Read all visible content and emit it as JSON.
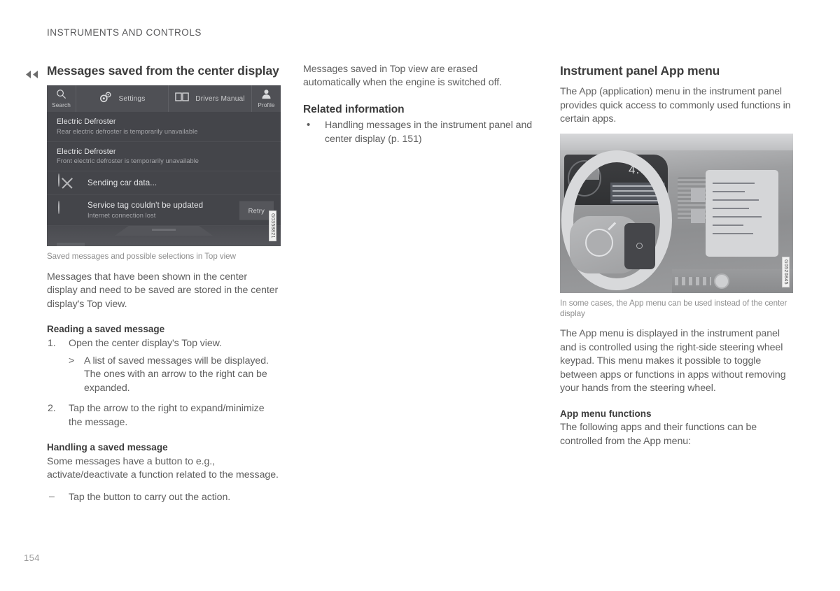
{
  "document": {
    "running_header": "INSTRUMENTS AND CONTROLS",
    "page_number": "154",
    "continuation_icon": "double-chevron-left-icon"
  },
  "column_left": {
    "section_title": "Messages saved from the center display",
    "figure": {
      "caption": "Saved messages and possible selections in Top view",
      "image_id": "G0358821",
      "top_bar": [
        {
          "icon": "search-icon",
          "label": "Search"
        },
        {
          "icon": "gears-icon",
          "label": "Settings"
        },
        {
          "icon": "book-icon",
          "label": "Drivers Manual"
        },
        {
          "icon": "profile-icon",
          "label": "Profile"
        }
      ],
      "messages": [
        {
          "title": "Electric Defroster",
          "subtitle": "Rear electric defroster is temporarily unavailable",
          "status_icon": "",
          "action": ""
        },
        {
          "title": "Electric Defroster",
          "subtitle": "Front electric defroster is temporarily unavailable",
          "status_icon": "",
          "action": ""
        },
        {
          "title": "Sending car data...",
          "subtitle": "",
          "status_icon": "circle-cross-icon",
          "action": ""
        },
        {
          "title": "Service tag couldn't be updated",
          "subtitle": "Internet connection lost",
          "status_icon": "circle-spinner-icon",
          "action": "Retry"
        }
      ]
    },
    "intro_paragraph": "Messages that have been shown in the center display and need to be saved are stored in the center display's Top view.",
    "reading_heading": "Reading a saved message",
    "reading_steps": [
      {
        "num": "1.",
        "text": "Open the center display's Top view."
      },
      {
        "num": "2.",
        "text": "Tap the arrow to the right to expand/minimize the message."
      }
    ],
    "reading_step1_result": "A list of saved messages will be displayed. The ones with an arrow to the right can be expanded.",
    "handling_heading": "Handling a saved message",
    "handling_paragraph": "Some messages have a button to e.g., activate/deactivate a function related to the message.",
    "handling_action": "Tap the button to carry out the action."
  },
  "column_middle": {
    "continued_paragraph": "Messages saved in Top view are erased automatically when the engine is switched off.",
    "related_heading": "Related information",
    "related_links": [
      "Handling messages in the instrument panel and center display (p. 151)"
    ]
  },
  "column_right": {
    "section_title": "Instrument panel App menu",
    "intro_paragraph": "The App (application) menu in the instrument panel provides quick access to commonly used functions in certain apps.",
    "figure": {
      "caption": "In some cases, the App menu can be used instead of the center display",
      "image_id": "G0520845"
    },
    "body_paragraph": "The App menu is displayed in the instrument panel and is controlled using the right-side steering wheel keypad. This menu makes it possible to toggle between apps or functions in apps without removing your hands from the steering wheel.",
    "functions_heading": "App menu functions",
    "functions_paragraph": "The following apps and their functions can be controlled from the App menu:"
  }
}
